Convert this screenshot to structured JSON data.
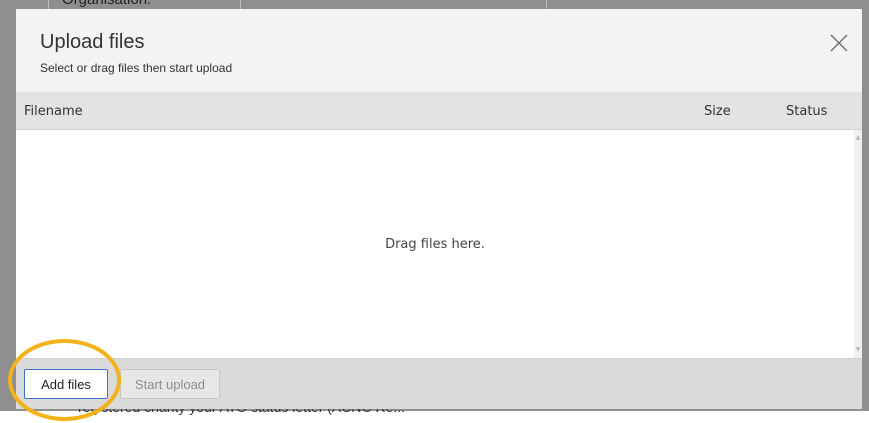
{
  "background": {
    "org_label": "Organisation:",
    "bottom_text": "registered charity your ATO status letter (ACNC Re..."
  },
  "modal": {
    "title": "Upload files",
    "subtitle": "Select or drag files then start upload",
    "close_glyph": "X",
    "columns": {
      "filename": "Filename",
      "size": "Size",
      "status": "Status"
    },
    "drop_text": "Drag files here.",
    "buttons": {
      "add": "Add files",
      "start": "Start upload"
    }
  },
  "colors": {
    "highlight": "#f3b318",
    "primary_border": "#3b73c4",
    "overlay": "#8f8f8f"
  }
}
